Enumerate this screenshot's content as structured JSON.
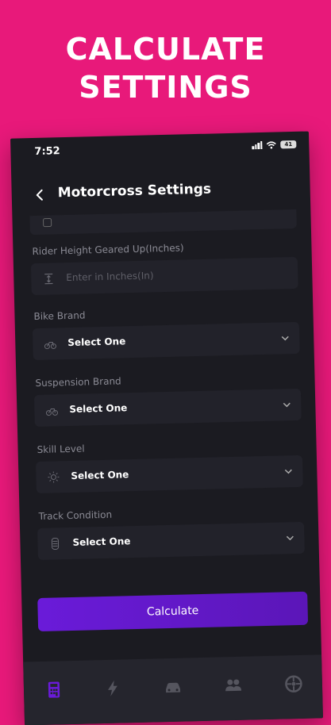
{
  "promo": {
    "line1": "CALCULATE",
    "line2": "SETTINGS"
  },
  "statusbar": {
    "time": "7:52",
    "battery": "41"
  },
  "navbar": {
    "title": "Motorcross Settings",
    "back_icon": "chevron-left-icon"
  },
  "form": {
    "fields": [
      {
        "label": "Rider Height Geared Up(Inches)",
        "placeholder": "Enter in Inches(In)",
        "icon": "height-icon"
      },
      {
        "label": "Bike Brand",
        "value": "Select One",
        "icon": "bike-icon"
      },
      {
        "label": "Suspension Brand",
        "value": "Select One",
        "icon": "bike-icon"
      },
      {
        "label": "Skill Level",
        "value": "Select One",
        "icon": "sun-icon"
      },
      {
        "label": "Track Condition",
        "value": "Select One",
        "icon": "tire-icon"
      }
    ]
  },
  "calculate_label": "Calculate",
  "tabbar": {
    "tabs": [
      {
        "icon": "calculator-icon",
        "active": true
      },
      {
        "icon": "lightning-icon",
        "active": false
      },
      {
        "icon": "car-icon",
        "active": false
      },
      {
        "icon": "users-icon",
        "active": false
      },
      {
        "icon": "wheel-icon",
        "active": false
      }
    ]
  },
  "colors": {
    "background": "#e8197a",
    "accent": "#6a1bd9",
    "screen": "#1b1b21"
  }
}
